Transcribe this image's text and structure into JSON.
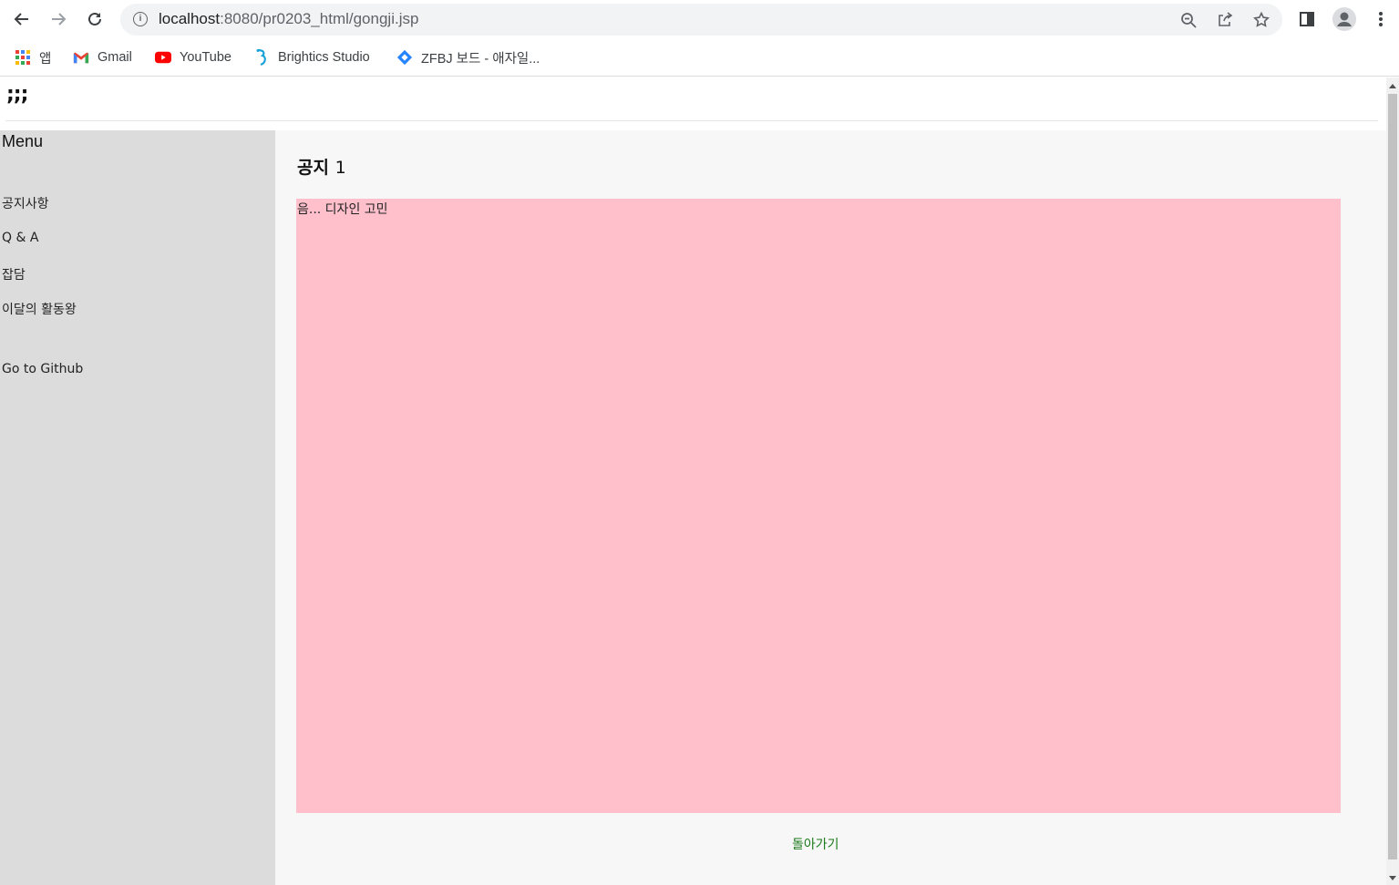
{
  "browser": {
    "url_host": "localhost",
    "url_path": ":8080/pr0203_html/gongji.jsp",
    "bookmarks": [
      {
        "label": "앱",
        "icon": "apps-grid-icon"
      },
      {
        "label": "Gmail",
        "icon": "gmail-icon"
      },
      {
        "label": "YouTube",
        "icon": "youtube-icon"
      },
      {
        "label": "Brightics Studio",
        "icon": "brightics-icon"
      },
      {
        "label": "ZFBJ 보드 - 애자일...",
        "icon": "jira-icon"
      }
    ]
  },
  "header": {
    "logo": ";;;"
  },
  "sidebar": {
    "title": "Menu",
    "items": [
      {
        "label": "공지사항"
      },
      {
        "label": "Q & A"
      },
      {
        "label": "잡담"
      },
      {
        "label": "이달의 활동왕"
      },
      {
        "label": "Go to Github"
      }
    ]
  },
  "post": {
    "title_prefix": "공지",
    "title_number": "1",
    "content": "음... 디자인 고민",
    "back_label": "돌아가기"
  },
  "colors": {
    "sidebar_bg": "#dcdcdc",
    "content_bg": "#ffc0cb",
    "back_link": "#1a7a1a"
  }
}
